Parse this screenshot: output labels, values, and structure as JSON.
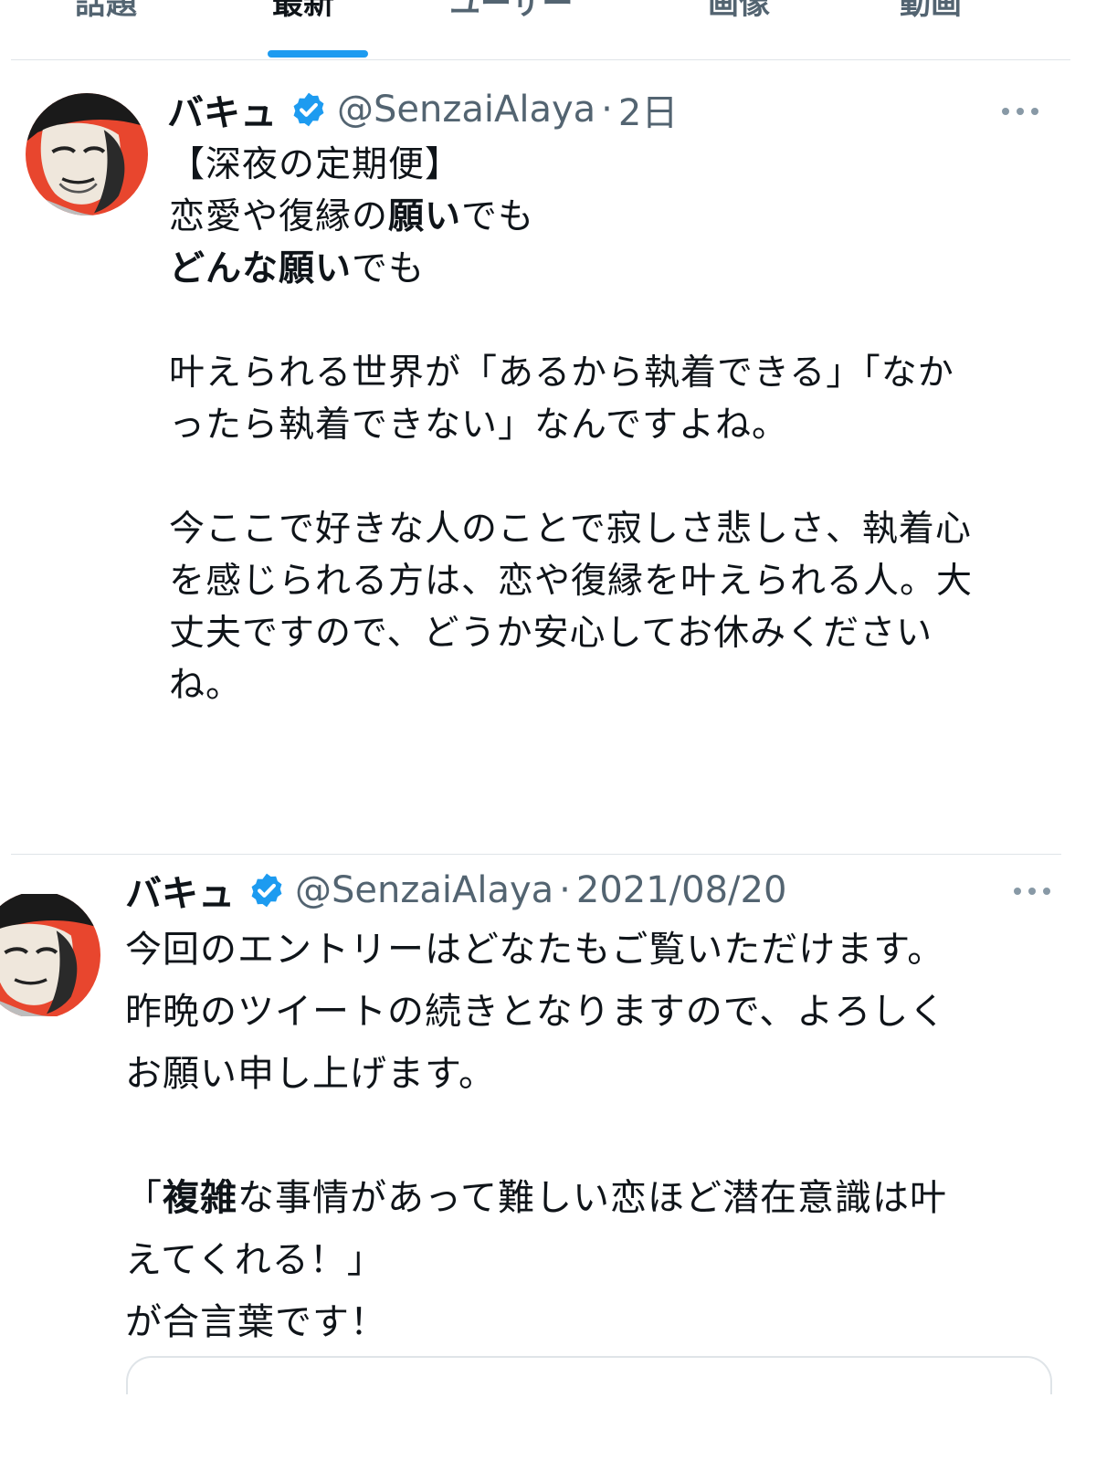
{
  "tabs": [
    {
      "label": "話題"
    },
    {
      "label": "最新"
    },
    {
      "label": "ユーザー"
    },
    {
      "label": "画像"
    },
    {
      "label": "動画"
    }
  ],
  "active_tab_index": 1,
  "colors": {
    "accent": "#1d9bf0",
    "secondary_text": "#536471",
    "divider": "#dfe4e8"
  },
  "tweets": [
    {
      "display_name": "バキュ",
      "verified_icon": "verified-badge-icon",
      "handle": "@SenzaiAlaya",
      "separator": "·",
      "timestamp": "2日",
      "lines": [
        [
          {
            "t": "【深夜の定期便】"
          }
        ],
        [
          {
            "t": "恋愛や復縁の"
          },
          {
            "t": "願い",
            "b": true
          },
          {
            "t": "でも"
          }
        ],
        [
          {
            "t": "どんな願い",
            "b": true
          },
          {
            "t": "でも"
          }
        ],
        [],
        [
          {
            "t": "叶えられる世界が「あるから執着できる」「なか"
          }
        ],
        [
          {
            "t": "ったら執着できない」なんですよね。"
          }
        ],
        [],
        [
          {
            "t": "今ここで好きな人のことで寂しさ悲しさ、執着心"
          }
        ],
        [
          {
            "t": "を感じられる方は、恋や復縁を叶えられる人。大"
          }
        ],
        [
          {
            "t": "丈夫ですので、どうか安心してお休みください"
          }
        ],
        [
          {
            "t": "ね。"
          }
        ]
      ]
    },
    {
      "display_name": "バキュ",
      "verified_icon": "verified-badge-icon",
      "handle": "@SenzaiAlaya",
      "separator": "·",
      "timestamp": "2021/08/20",
      "lines": [
        [
          {
            "t": "今回のエントリーはどなたもご覧いただけます。"
          }
        ],
        [
          {
            "t": "昨晩のツイートの続きとなりますので、よろしく"
          }
        ],
        [
          {
            "t": "お願い申し上げます。"
          }
        ],
        [],
        [
          {
            "t": "「"
          },
          {
            "t": "複雑",
            "b": true
          },
          {
            "t": "な事情があって難しい恋ほど潜在意識は叶"
          }
        ],
        [
          {
            "t": "えてくれる！」"
          }
        ],
        [
          {
            "t": "が合言葉です！"
          }
        ]
      ]
    }
  ]
}
